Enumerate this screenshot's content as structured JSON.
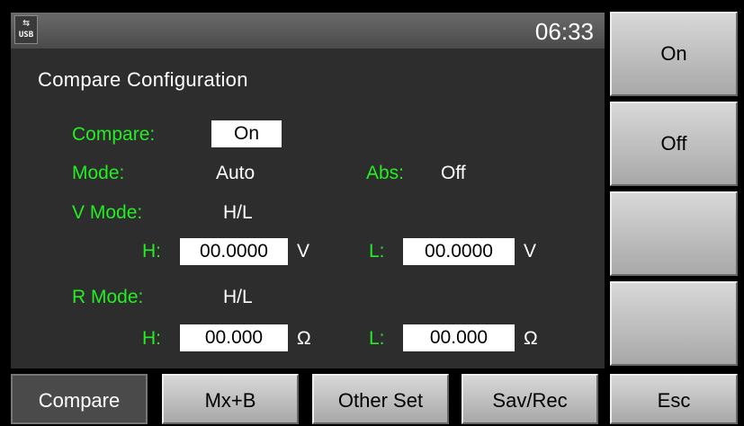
{
  "status": {
    "usb_label": "USB",
    "time": "06:33"
  },
  "panel": {
    "title": "Compare Configuration",
    "compare_label": "Compare:",
    "compare_value": "On",
    "mode_label": "Mode:",
    "mode_value": "Auto",
    "abs_label": "Abs:",
    "abs_value": "Off",
    "vmode_label": "V Mode:",
    "vmode_value": "H/L",
    "v_h_label": "H:",
    "v_h_value": "00.0000",
    "v_h_unit": "V",
    "v_l_label": "L:",
    "v_l_value": "00.0000",
    "v_l_unit": "V",
    "rmode_label": "R Mode:",
    "rmode_value": "H/L",
    "r_h_label": "H:",
    "r_h_value": "00.000",
    "r_h_unit": "Ω",
    "r_l_label": "L:",
    "r_l_value": "00.000",
    "r_l_unit": "Ω"
  },
  "softkeys": [
    "On",
    "Off",
    "",
    ""
  ],
  "tabs": [
    "Compare",
    "Mx+B",
    "Other Set",
    "Sav/Rec",
    "Esc"
  ],
  "colors": {
    "label_green": "#22ee22",
    "panel_bg": "#2d2d2d",
    "button_gray": "#c0c0c0"
  }
}
